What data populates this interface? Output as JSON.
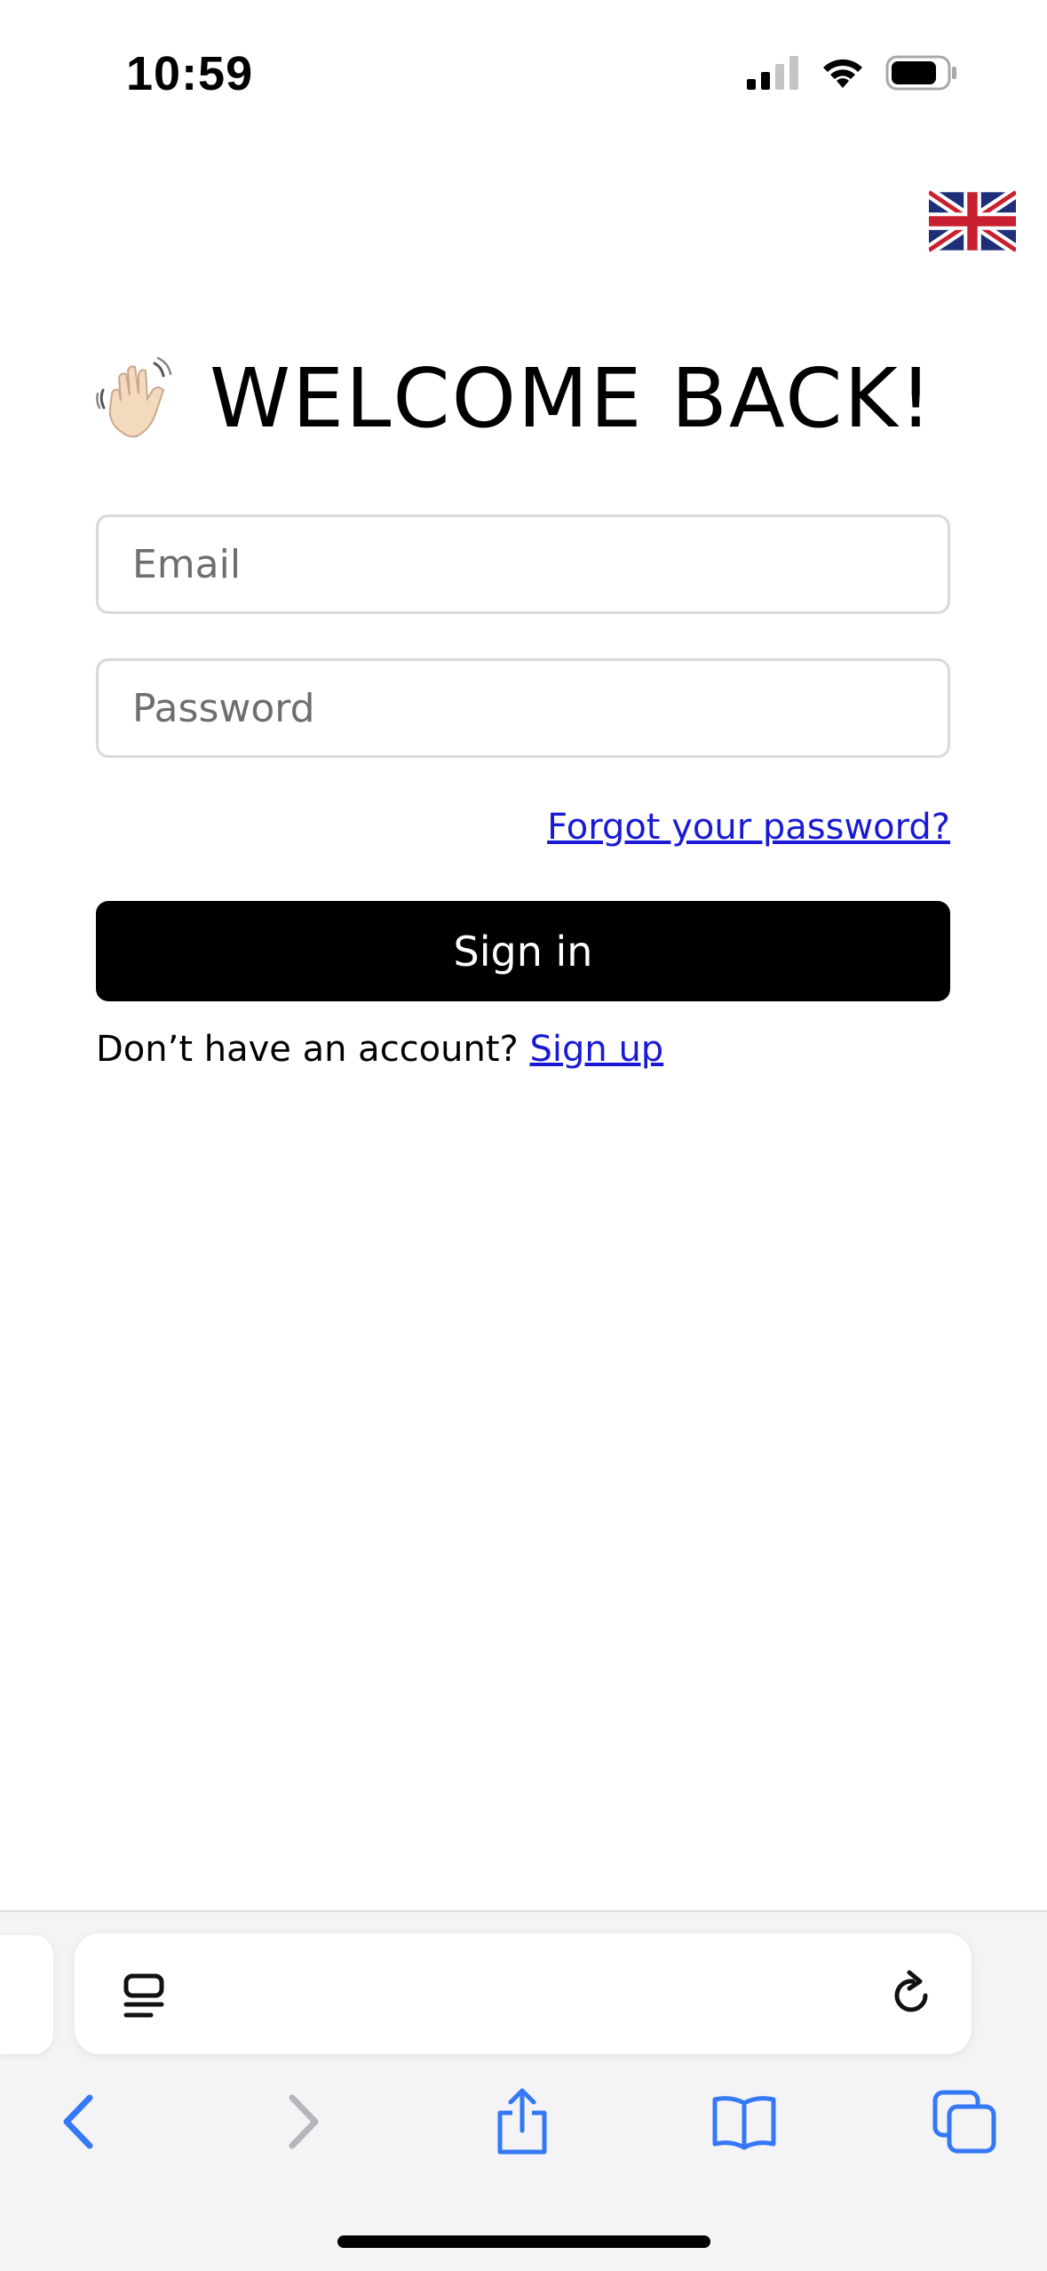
{
  "status_bar": {
    "time": "10:59"
  },
  "language": {
    "icon": "uk-flag-icon"
  },
  "login": {
    "wave_icon": "waving-hand-icon",
    "title": "WELCOME BACK!",
    "email_placeholder": "Email",
    "password_placeholder": "Password",
    "forgot_label": "Forgot your password?",
    "signin_label": "Sign in",
    "no_account_text": "Don’t have an account? ",
    "signup_label": "Sign up"
  },
  "colors": {
    "link": "#1a1ad6",
    "button_bg": "#000000",
    "system_blue": "#3478f6"
  },
  "browser": {
    "icons": [
      "reader-icon",
      "reload-icon",
      "back-icon",
      "forward-icon",
      "share-icon",
      "bookmarks-icon",
      "tabs-icon"
    ]
  }
}
